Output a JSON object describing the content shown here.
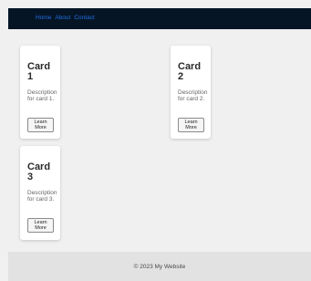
{
  "nav": {
    "links": [
      "Home",
      "About",
      "Contact"
    ]
  },
  "cards": [
    {
      "title": "Card 1",
      "description": "Description for card 1.",
      "button_label": "Learn More"
    },
    {
      "title": "Card 2",
      "description": "Description for card 2.",
      "button_label": "Learn More"
    },
    {
      "title": "Card 3",
      "description": "Description for card 3.",
      "button_label": "Learn More"
    }
  ],
  "footer": {
    "text": "© 2023 My Website"
  },
  "colors": {
    "page_background": "#f0f0f0",
    "navbar_background": "#061526",
    "nav_link": "#1f6fe0",
    "card_background": "#ffffff",
    "footer_background": "#e2e2e2"
  }
}
